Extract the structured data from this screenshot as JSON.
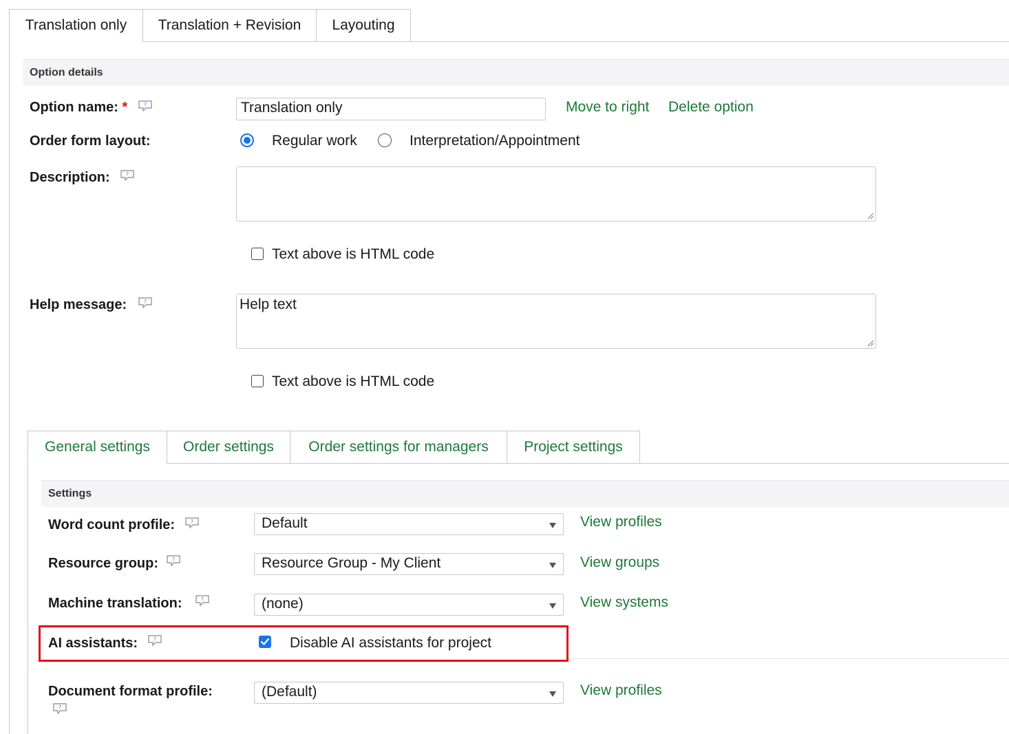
{
  "top_tabs": [
    {
      "label": "Translation only",
      "active": true
    },
    {
      "label": "Translation + Revision",
      "active": false
    },
    {
      "label": "Layouting",
      "active": false
    }
  ],
  "option_details": {
    "section_title": "Option details",
    "option_name_label": "Option name:",
    "required_mark": "*",
    "option_name_value": "Translation only",
    "move_link": "Move to right",
    "delete_link": "Delete option",
    "layout_label": "Order form layout:",
    "layout_options": [
      {
        "label": "Regular work",
        "selected": true
      },
      {
        "label": "Interpretation/Appointment",
        "selected": false
      }
    ],
    "description_label": "Description:",
    "description_value": "",
    "description_html_label": "Text above is HTML code",
    "description_html_checked": false,
    "help_label": "Help message:",
    "help_value": "Help text",
    "help_html_label": "Text above is HTML code",
    "help_html_checked": false
  },
  "inner_tabs": [
    {
      "label": "General settings",
      "active": true
    },
    {
      "label": "Order settings",
      "active": false
    },
    {
      "label": "Order settings for managers",
      "active": false
    },
    {
      "label": "Project settings",
      "active": false
    }
  ],
  "settings": {
    "section_title": "Settings",
    "word_count": {
      "label": "Word count profile:",
      "value": "Default",
      "link": "View profiles"
    },
    "resource_group": {
      "label": "Resource group:",
      "value": "Resource Group - My Client",
      "link": "View groups"
    },
    "machine_translation": {
      "label": "Machine translation:",
      "value": "(none)",
      "link": "View systems"
    },
    "ai_assistants": {
      "label": "AI assistants:",
      "checkbox_label": "Disable AI assistants for project",
      "checked": true
    },
    "document_format": {
      "label": "Document format profile:",
      "value": "(Default)",
      "link": "View profiles"
    }
  },
  "colors": {
    "link_green": "#1c7a37",
    "highlight_red": "#e0111a",
    "check_blue": "#1a73e8"
  }
}
